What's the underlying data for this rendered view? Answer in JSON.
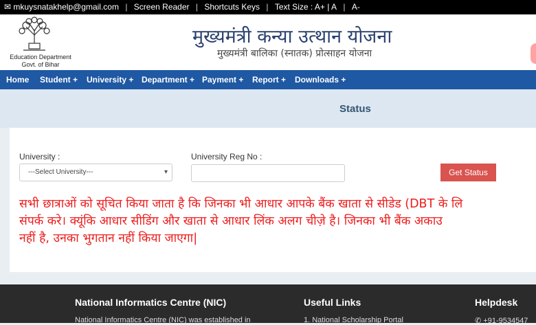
{
  "topbar": {
    "email": "mkuysnatakhelp@gmail.com",
    "screen_reader": "Screen Reader",
    "shortcuts": "Shortcuts Keys",
    "text_size": "Text Size : A+ | A",
    "text_smaller": "A-"
  },
  "header": {
    "dept_line1": "Education Department",
    "dept_line2": "Govt. of Bihar",
    "title": "मुख्यमंत्री कन्या उत्थान योजना",
    "subtitle": "मुख्यमंत्री बालिका (स्नातक) प्रोत्साहन योजना"
  },
  "nav": {
    "items": [
      "Home",
      "Student +",
      "University +",
      "Department +",
      "Payment +",
      "Report +",
      "Downloads +"
    ]
  },
  "status": {
    "title": "Status"
  },
  "form": {
    "university_label": "University :",
    "university_selected": "---Select University---",
    "reg_label": "University Reg No :",
    "reg_value": "",
    "submit_label": "Get Status"
  },
  "notice": {
    "line1": "सभी छात्राओं को सूचित किया जाता है कि जिनका भी आधार आपके बैंक खाता से सीडेड (DBT के लि",
    "line2": "संपर्क करे। क्यूंकि आधार सीडिंग और खाता से आधार लिंक अलग चीज़े है। जिनका भी बैंक अकाउ",
    "line3": "नहीं है, उनका भुगतान नहीं किया जाएगा|"
  },
  "footer": {
    "nic_heading": "National Informatics Centre (NIC)",
    "nic_text": "National Informatics Centre (NIC) was established in",
    "links_heading": "Useful Links",
    "links_first": "1. National Scholarship Portal",
    "help_heading": "Helpdesk",
    "help_phone": "+91-9534547"
  },
  "colors": {
    "nav_bg": "#1f58a3",
    "button_bg": "#d9534f",
    "notice_text": "#ee1c1c",
    "title_text": "#2a4170"
  }
}
